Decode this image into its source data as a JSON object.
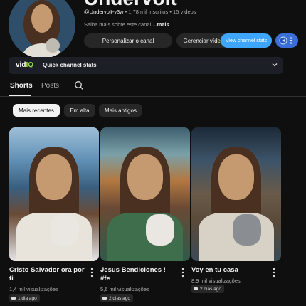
{
  "channel": {
    "name": "Undervolt",
    "handle": "@Undervolt-v3w",
    "subscribers": "1,78 mil inscritos",
    "videos": "15 vídeos",
    "about": "Saiba mais sobre este canal",
    "about_more": "...mais"
  },
  "actions": {
    "customize": "Personalizar o canal",
    "manage": "Gerenciar vídeos",
    "view_stats": "View channel stats"
  },
  "vidiq": {
    "logo_left": "vid",
    "logo_right": "IQ",
    "label": "Quick channel stats"
  },
  "tabs": [
    {
      "label": "Shorts",
      "active": true
    },
    {
      "label": "Posts",
      "active": false
    }
  ],
  "filters": [
    {
      "label": "Mais recentes",
      "selected": true
    },
    {
      "label": "Em alta",
      "selected": false
    },
    {
      "label": "Mais antigos",
      "selected": false
    }
  ],
  "shorts": [
    {
      "title_1": "Cristo Salvador ora por",
      "title_2": "ti",
      "views": "1,4 mil visualizações",
      "date": "1 dia ago"
    },
    {
      "title_1": "Jesus Bendiciones !",
      "title_2": "#fe",
      "views": "5,6 mil visualizações",
      "date": "2 dias ago"
    },
    {
      "title_1": "Voy en tu casa",
      "title_2": "",
      "views": "8,9 mil visualizações",
      "date": "2 dias ago"
    }
  ],
  "icons": {
    "search": "search-icon",
    "more": "more-vert-icon",
    "chevron": "chevron-down-icon",
    "stats": "vidiq-icon",
    "short": "shorts-icon"
  },
  "colors": {
    "background": "#0f0f0f",
    "accent": "#3ea6ff",
    "vidiq_green": "#9adf43"
  }
}
